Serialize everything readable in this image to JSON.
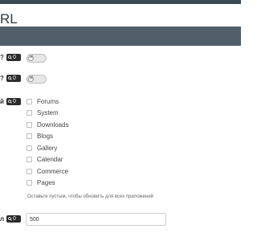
{
  "header": {
    "title": "RL"
  },
  "settings": [
    {
      "label": "?",
      "badge": "0"
    },
    {
      "label": "?",
      "badge": "0"
    },
    {
      "label": "й",
      "badge": "0"
    }
  ],
  "apps": [
    "Forums",
    "System",
    "Downloads",
    "Blogs",
    "Gallery",
    "Calendar",
    "Commerce",
    "Pages"
  ],
  "hint": "Оставьте пустым, чтобы обновить для всех приложений",
  "field": {
    "label": "л",
    "badge": "0",
    "value": "500"
  },
  "colors": {
    "top_strip": "#3c4a55",
    "bar": "#515f6a",
    "badge": "#2b2b2b"
  }
}
